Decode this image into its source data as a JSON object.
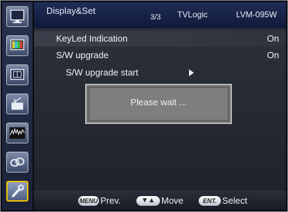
{
  "header": {
    "menu_title": "Display&Set",
    "page": "3/3",
    "brand": "TVLogic",
    "model": "LVM-095W"
  },
  "sidebar": {
    "items": [
      {
        "icon": "monitor-icon"
      },
      {
        "icon": "color-picture-icon"
      },
      {
        "icon": "marker-icon"
      },
      {
        "icon": "audio-icon"
      },
      {
        "icon": "waveform-icon"
      },
      {
        "icon": "link-icon"
      },
      {
        "icon": "wrench-icon",
        "active": true
      }
    ]
  },
  "menu": {
    "items": [
      {
        "label": "KeyLed Indication",
        "value": "On"
      },
      {
        "label": "S/W upgrade",
        "value": "On"
      },
      {
        "label": "S/W upgrade start",
        "value": ""
      }
    ]
  },
  "dialog": {
    "message": "Please wait ..."
  },
  "footer": {
    "menu_key": "MENU",
    "menu_label": "Prev.",
    "move_key": "▼▲",
    "move_label": "Move",
    "enter_key": "ENT.",
    "enter_label": "Select"
  }
}
